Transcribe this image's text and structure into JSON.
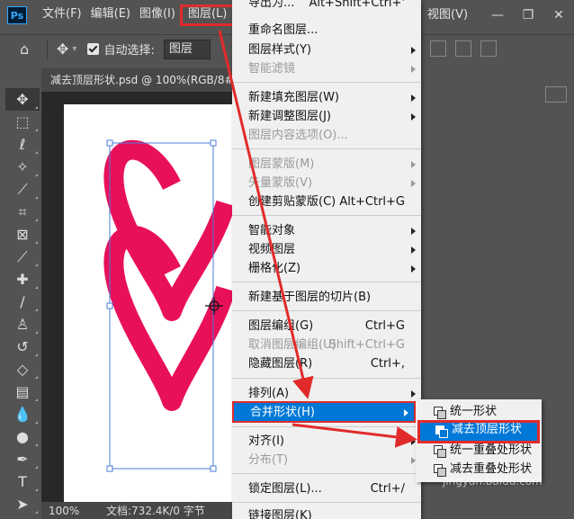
{
  "app": {
    "logo": "Ps"
  },
  "menubar": {
    "items": [
      {
        "label": "文件(F)"
      },
      {
        "label": "编辑(E)"
      },
      {
        "label": "图像(I)"
      },
      {
        "label": "图层(L)"
      }
    ],
    "right_item": "视图(V)",
    "window_buttons": [
      "—",
      "❐",
      "✕"
    ]
  },
  "options_bar": {
    "auto_select_label": "自动选择:",
    "auto_select_value": "图层",
    "auto_select_checked": true
  },
  "document": {
    "tab_title": "减去顶层形状.psd @ 100%(RGB/8#)",
    "zoom": "100%",
    "info": "文档:732.4K/0 字节"
  },
  "layer_menu": {
    "items": [
      {
        "label": "导出为...",
        "shortcut": "Alt+Shift+Ctrl+'",
        "disabled": false,
        "submenu": false
      },
      {
        "label": "重命名图层...",
        "shortcut": "",
        "disabled": false,
        "submenu": false
      },
      {
        "label": "图层样式(Y)",
        "shortcut": "",
        "disabled": false,
        "submenu": true
      },
      {
        "label": "智能滤镜",
        "shortcut": "",
        "disabled": true,
        "submenu": true
      },
      {
        "label": "新建填充图层(W)",
        "shortcut": "",
        "disabled": false,
        "submenu": true
      },
      {
        "label": "新建调整图层(J)",
        "shortcut": "",
        "disabled": false,
        "submenu": true
      },
      {
        "label": "图层内容选项(O)...",
        "shortcut": "",
        "disabled": true,
        "submenu": false
      },
      {
        "label": "图层蒙版(M)",
        "shortcut": "",
        "disabled": true,
        "submenu": true
      },
      {
        "label": "矢量蒙版(V)",
        "shortcut": "",
        "disabled": true,
        "submenu": true
      },
      {
        "label": "创建剪贴蒙版(C)",
        "shortcut": "Alt+Ctrl+G",
        "disabled": false,
        "submenu": false
      },
      {
        "label": "智能对象",
        "shortcut": "",
        "disabled": false,
        "submenu": true
      },
      {
        "label": "视频图层",
        "shortcut": "",
        "disabled": false,
        "submenu": true
      },
      {
        "label": "栅格化(Z)",
        "shortcut": "",
        "disabled": false,
        "submenu": true
      },
      {
        "label": "新建基于图层的切片(B)",
        "shortcut": "",
        "disabled": false,
        "submenu": false
      },
      {
        "label": "图层编组(G)",
        "shortcut": "Ctrl+G",
        "disabled": false,
        "submenu": false
      },
      {
        "label": "取消图层编组(U)",
        "shortcut": "Shift+Ctrl+G",
        "disabled": true,
        "submenu": false
      },
      {
        "label": "隐藏图层(R)",
        "shortcut": "Ctrl+,",
        "disabled": false,
        "submenu": false
      },
      {
        "label": "排列(A)",
        "shortcut": "",
        "disabled": false,
        "submenu": true
      },
      {
        "label": "合并形状(H)",
        "shortcut": "",
        "disabled": false,
        "submenu": true,
        "highlighted": true
      },
      {
        "label": "对齐(I)",
        "shortcut": "",
        "disabled": false,
        "submenu": true
      },
      {
        "label": "分布(T)",
        "shortcut": "",
        "disabled": true,
        "submenu": true
      },
      {
        "label": "锁定图层(L)...",
        "shortcut": "Ctrl+/",
        "disabled": false,
        "submenu": false
      },
      {
        "label": "链接图层(K)",
        "shortcut": "",
        "disabled": false,
        "submenu": false
      }
    ]
  },
  "combine_submenu": {
    "items": [
      {
        "label": "统一形状"
      },
      {
        "label": "减去顶层形状",
        "highlighted": true
      },
      {
        "label": "统一重叠处形状"
      },
      {
        "label": "减去重叠处形状"
      }
    ]
  },
  "watermark": "jingyan.baidu.com",
  "colors": {
    "accent": "#0078d7",
    "annotation": "#e12b2b",
    "heart": "#e8105a"
  }
}
